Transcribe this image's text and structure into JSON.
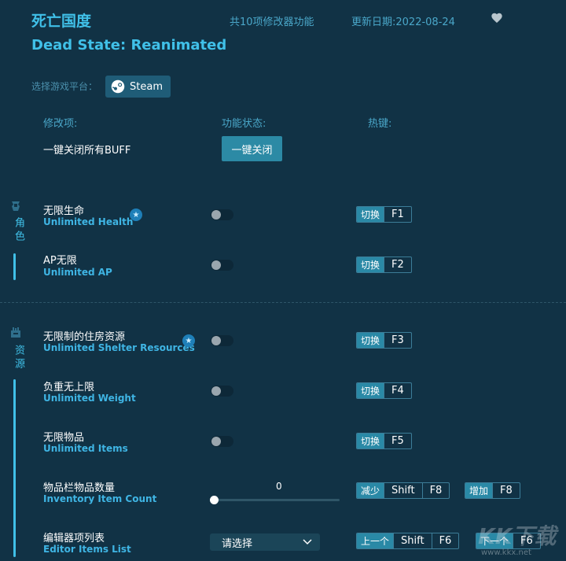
{
  "header": {
    "title_cn": "死亡国度",
    "title_en": "Dead State: Reanimated",
    "feature_count": "共10项修改器功能",
    "update_date": "更新日期:2022-08-24",
    "favorite_icon": "heart-icon"
  },
  "platform": {
    "label": "选择游戏平台：",
    "button": "Steam",
    "icon": "steam-icon"
  },
  "columns": {
    "item": "修改项:",
    "status": "功能状态:",
    "hotkey": "热键:"
  },
  "global": {
    "label": "一键关闭所有BUFF",
    "button": "一键关闭"
  },
  "categories": [
    {
      "label": "角色",
      "icon": "character-icon"
    },
    {
      "label": "资源",
      "icon": "resource-icon"
    }
  ],
  "items": [
    {
      "cn": "无限生命",
      "en": "Unlimited Health",
      "starred": true,
      "enabled": false,
      "action": "切换",
      "key": "F1"
    },
    {
      "cn": "AP无限",
      "en": "Unlimited AP",
      "starred": false,
      "enabled": false,
      "action": "切换",
      "key": "F2"
    },
    {
      "cn": "无限制的住房资源",
      "en": "Unlimited Shelter Resources",
      "starred": true,
      "enabled": false,
      "action": "切换",
      "key": "F3"
    },
    {
      "cn": "负重无上限",
      "en": "Unlimited Weight",
      "starred": false,
      "enabled": false,
      "action": "切换",
      "key": "F4"
    },
    {
      "cn": "无限物品",
      "en": "Unlimited Items",
      "starred": false,
      "enabled": false,
      "action": "切换",
      "key": "F5"
    }
  ],
  "inventory": {
    "cn": "物品栏物品数量",
    "en": "Inventory Item Count",
    "value": "0",
    "slider_fraction": 0,
    "dec_action": "减少",
    "dec_mod": "Shift",
    "dec_key": "F8",
    "inc_action": "增加",
    "inc_key": "F8"
  },
  "editor": {
    "cn": "编辑器项列表",
    "en": "Editor Items List",
    "select_placeholder": "请选择",
    "prev_action": "上一个",
    "prev_mod": "Shift",
    "prev_key": "F6",
    "next_action": "下一个",
    "next_key": "F6"
  },
  "watermark": {
    "logo": "KK下载",
    "url": "www.kkx.net"
  }
}
